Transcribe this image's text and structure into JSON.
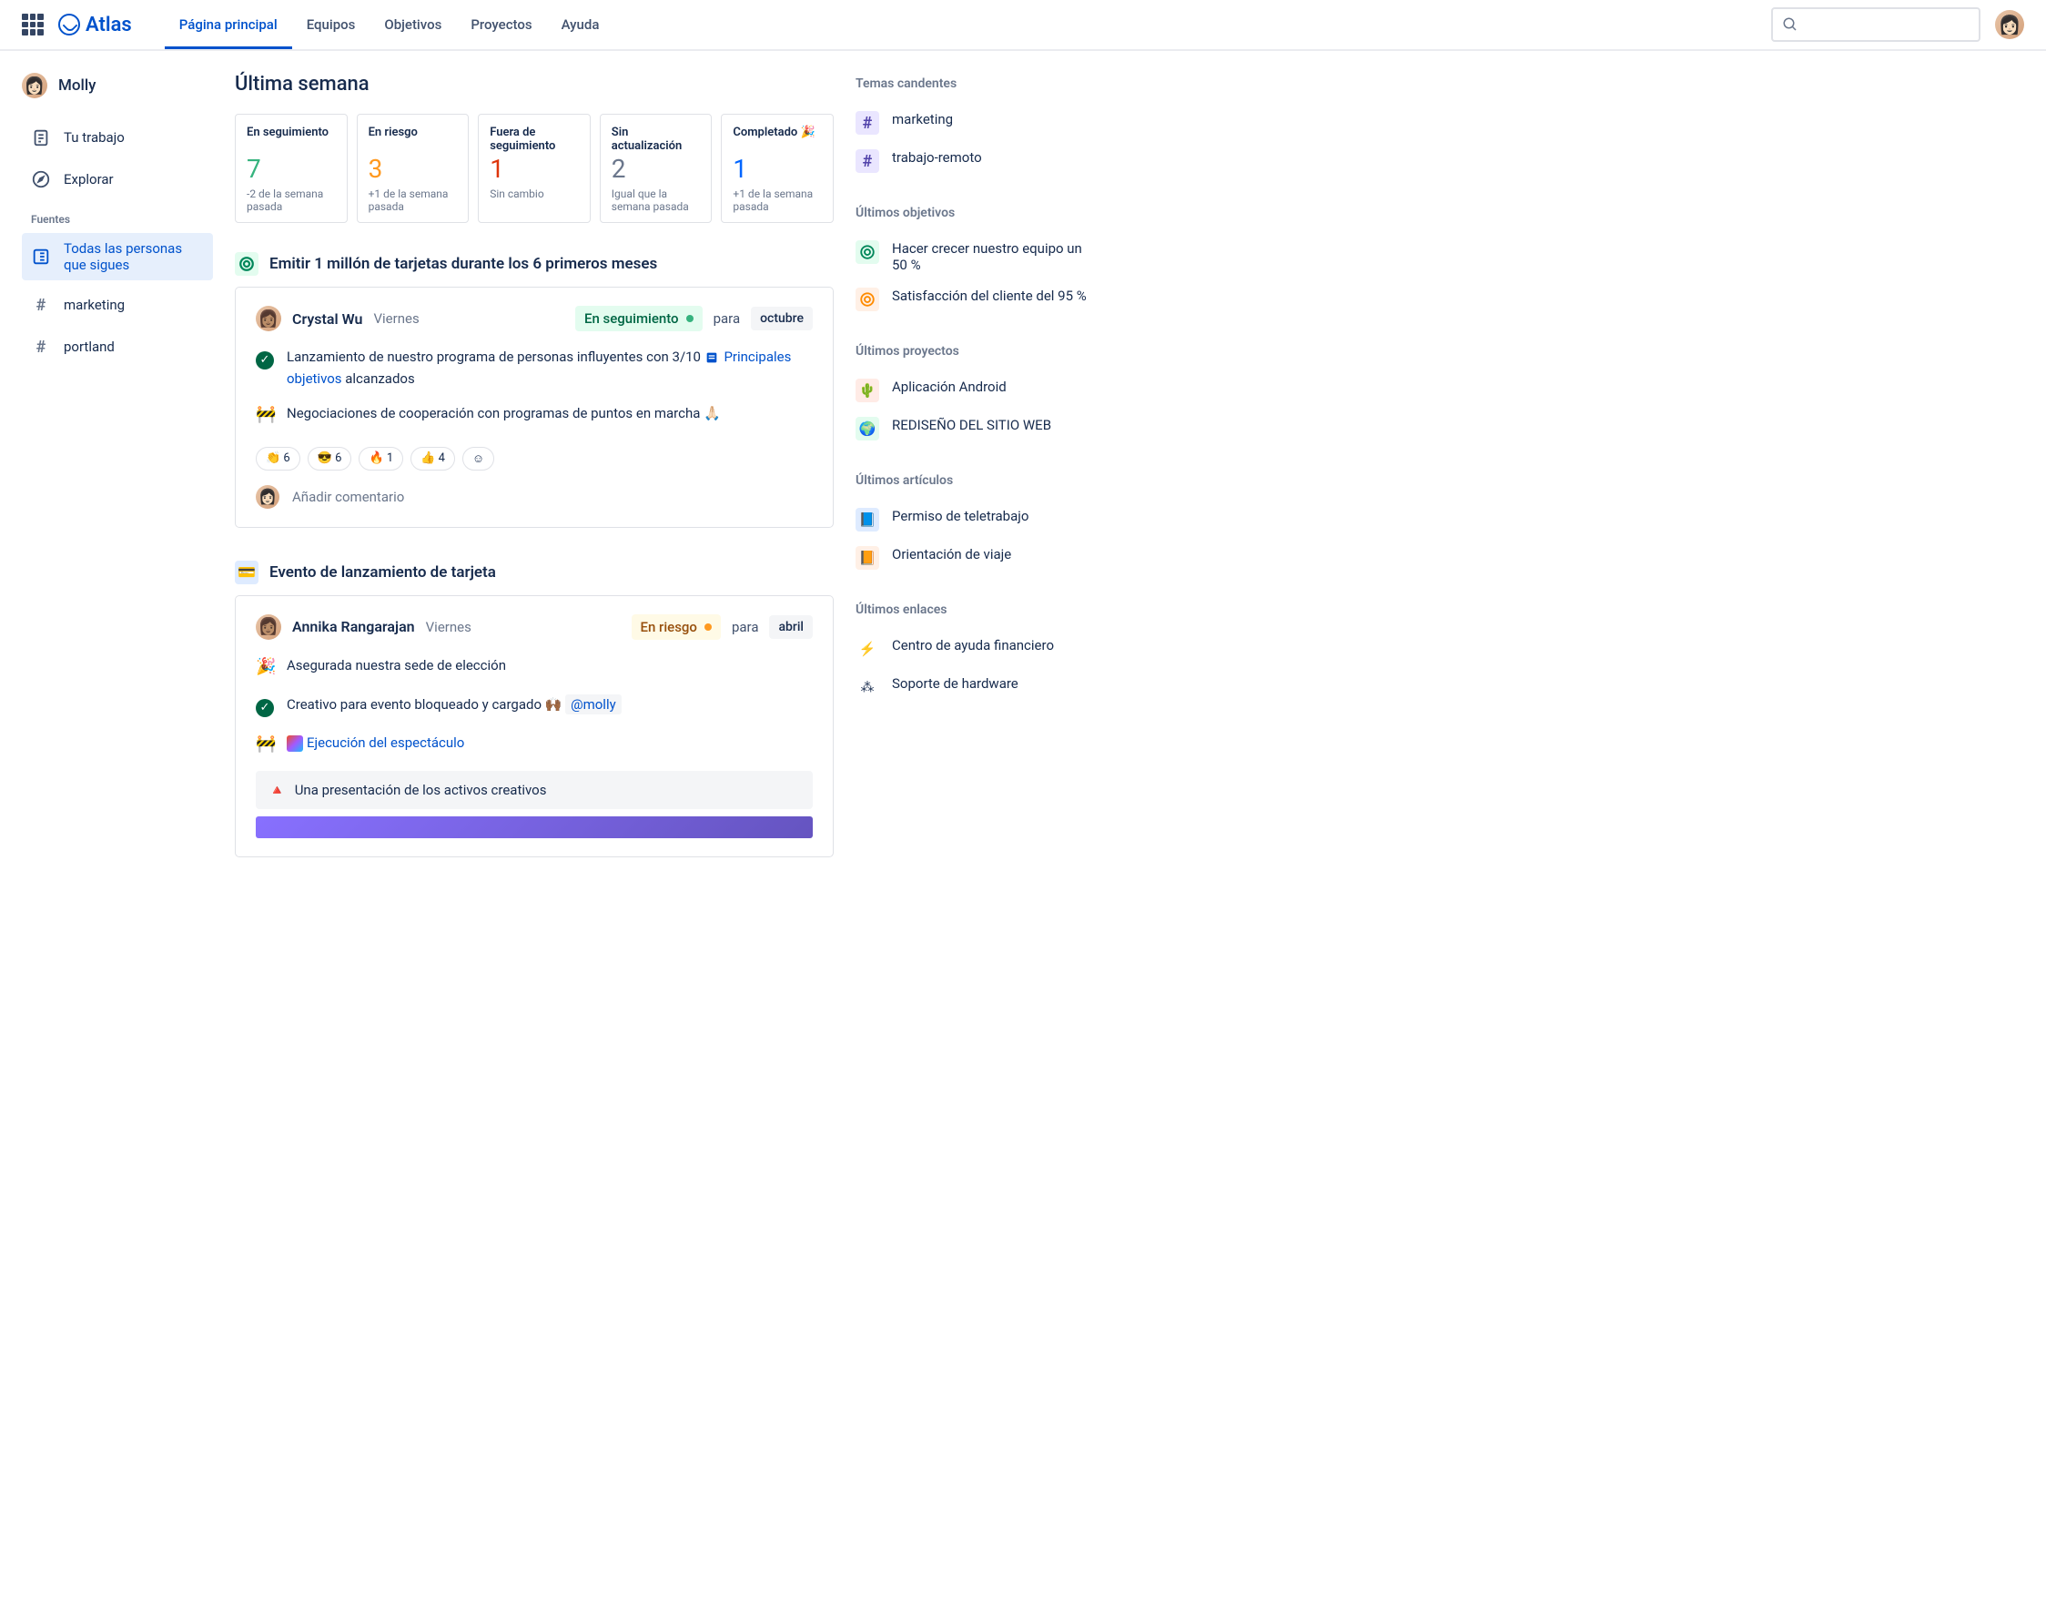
{
  "brand": "Atlas",
  "nav": {
    "home": "Página principal",
    "teams": "Equipos",
    "goals": "Objetivos",
    "projects": "Proyectos",
    "help": "Ayuda"
  },
  "search_placeholder": "",
  "sidebar": {
    "user": "Molly",
    "your_work": "Tu trabajo",
    "explore": "Explorar",
    "sources_label": "Fuentes",
    "all_follow": "Todas las personas que sigues",
    "tags": [
      "marketing",
      "portland"
    ]
  },
  "main": {
    "title": "Última semana",
    "stats": [
      {
        "label": "En seguimiento",
        "num": "7",
        "delta": "-2 de la semana pasada",
        "color": "c-green"
      },
      {
        "label": "En riesgo",
        "num": "3",
        "delta": "+1 de la semana pasada",
        "color": "c-orange"
      },
      {
        "label": "Fuera de seguimiento",
        "num": "1",
        "delta": "Sin cambio",
        "color": "c-red"
      },
      {
        "label": "Sin actualización",
        "num": "2",
        "delta": "Igual que la semana pasada",
        "color": "c-gray"
      },
      {
        "label": "Completado 🎉",
        "num": "1",
        "delta": "+1 de la semana pasada",
        "color": "c-blue"
      }
    ],
    "feed": [
      {
        "icon_bg": "#E3FCEF",
        "icon_glyph": "◎",
        "icon_color": "#00875A",
        "title": "Emitir 1 millón de tarjetas durante los 6 primeros meses",
        "author": "Crystal Wu",
        "day": "Viernes",
        "status": {
          "text": "En seguimiento",
          "class": "pill-green"
        },
        "para": "para",
        "month": "octubre",
        "lines": [
          {
            "icon": "check",
            "text_pre": "Lanzamiento de nuestro programa de personas influyentes con 3/10 ",
            "link": "Principales objetivos",
            "link_icon": true,
            "text_post": " alcanzados"
          },
          {
            "icon": "🚧",
            "text_pre": "Negociaciones de cooperación con programas de puntos en marcha 🙏🏻"
          }
        ],
        "reactions": [
          {
            "emoji": "👏",
            "count": "6"
          },
          {
            "emoji": "😎",
            "count": "6"
          },
          {
            "emoji": "🔥",
            "count": "1"
          },
          {
            "emoji": "👍",
            "count": "4"
          },
          {
            "emoji": "☺",
            "count": ""
          }
        ],
        "comment_placeholder": "Añadir comentario"
      },
      {
        "icon_bg": "#DEEBFF",
        "icon_glyph": "💳",
        "icon_color": "#172B4D",
        "title": "Evento de lanzamiento de tarjeta",
        "author": "Annika Rangarajan",
        "day": "Viernes",
        "status": {
          "text": "En riesgo",
          "class": "pill-yellow"
        },
        "para": "para",
        "month": "abril",
        "lines": [
          {
            "icon": "🎉",
            "text_pre": "Asegurada nuestra sede de elección"
          },
          {
            "icon": "check",
            "text_pre": "Creativo para evento bloqueado y cargado 🙌🏾 ",
            "mention": "@molly"
          },
          {
            "icon": "🚧",
            "figma": true,
            "link": "Ejecución del espectáculo"
          }
        ],
        "attachment": "Una presentación de los activos creativos"
      }
    ]
  },
  "right": {
    "hot_topics": {
      "title": "Temas candentes",
      "items": [
        "marketing",
        "trabajo-remoto"
      ]
    },
    "goals": {
      "title": "Últimos objetivos",
      "items": [
        {
          "icon": "target-g",
          "text": "Hacer crecer nuestro equipo un 50 %"
        },
        {
          "icon": "target-o",
          "text": "Satisfacción del cliente del 95 %"
        }
      ]
    },
    "projects": {
      "title": "Últimos proyectos",
      "items": [
        {
          "emoji": "🌵",
          "bg": "#FFEBE6",
          "text": "Aplicación Android"
        },
        {
          "emoji": "🌍",
          "bg": "#E3FCEF",
          "text": "REDISEÑO DEL SITIO WEB"
        }
      ]
    },
    "articles": {
      "title": "Últimos artículos",
      "items": [
        {
          "emoji": "📘",
          "bg": "#DEEBFF",
          "text": "Permiso de teletrabajo"
        },
        {
          "emoji": "📙",
          "bg": "#FFF0E6",
          "text": "Orientación de viaje"
        }
      ]
    },
    "links": {
      "title": "Últimos enlaces",
      "items": [
        {
          "emoji": "⚡",
          "bg": "#fff",
          "text": "Centro de ayuda financiero"
        },
        {
          "emoji": "⁂",
          "bg": "#fff",
          "text": "Soporte de hardware"
        }
      ]
    }
  }
}
